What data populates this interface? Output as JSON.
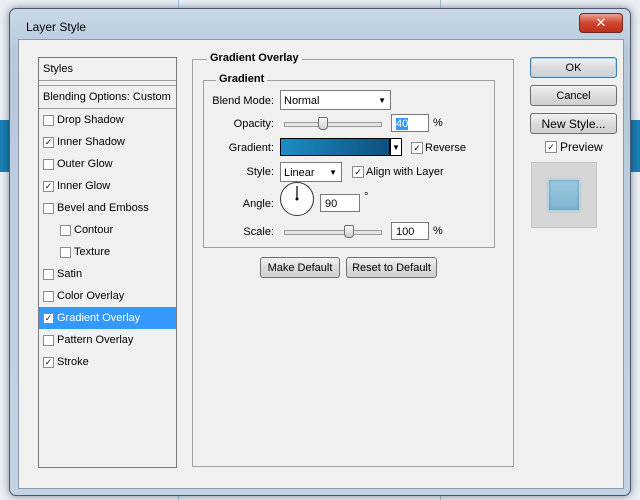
{
  "window": {
    "title": "Layer Style",
    "close_glyph": "✕"
  },
  "styles_panel": {
    "header": "Styles",
    "blending_options": "Blending Options: Custom",
    "items": [
      {
        "label": "Drop Shadow",
        "checked": false
      },
      {
        "label": "Inner Shadow",
        "checked": true
      },
      {
        "label": "Outer Glow",
        "checked": false
      },
      {
        "label": "Inner Glow",
        "checked": true
      },
      {
        "label": "Bevel and Emboss",
        "checked": false
      },
      {
        "label": "Contour",
        "checked": false
      },
      {
        "label": "Texture",
        "checked": false
      },
      {
        "label": "Satin",
        "checked": false
      },
      {
        "label": "Color Overlay",
        "checked": false
      },
      {
        "label": "Gradient Overlay",
        "checked": true
      },
      {
        "label": "Pattern Overlay",
        "checked": false
      },
      {
        "label": "Stroke",
        "checked": true
      }
    ]
  },
  "gradient_overlay": {
    "group_title": "Gradient Overlay",
    "subgroup_title": "Gradient",
    "blend_mode_label": "Blend Mode:",
    "blend_mode_value": "Normal",
    "opacity_label": "Opacity:",
    "opacity_value": "40",
    "opacity_unit": "%",
    "opacity_fraction": 0.4,
    "gradient_label": "Gradient:",
    "gradient_colors": [
      "#0e4f7f",
      "#1b8ec4"
    ],
    "reverse_label": "Reverse",
    "reverse_checked": true,
    "style_label": "Style:",
    "style_value": "Linear",
    "align_label": "Align with Layer",
    "align_checked": true,
    "angle_label": "Angle:",
    "angle_value": "90",
    "angle_unit": "°",
    "scale_label": "Scale:",
    "scale_value": "100",
    "scale_unit": "%",
    "scale_fraction": 0.67,
    "make_default": "Make Default",
    "reset_default": "Reset to Default"
  },
  "right_buttons": {
    "ok": "OK",
    "cancel": "Cancel",
    "new_style": "New Style...",
    "preview_label": "Preview",
    "preview_checked": true
  },
  "check_glyph": "✓",
  "dropdown_glyph": "▼",
  "colors": {
    "selection": "#3399ff",
    "canvas_accent": "#1a7fb5"
  }
}
